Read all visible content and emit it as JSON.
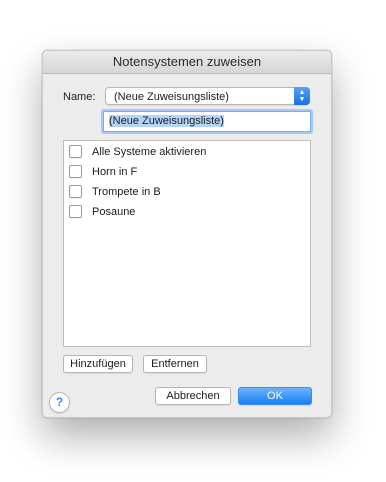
{
  "dialog": {
    "title": "Notensystemen zuweisen",
    "name_label": "Name:",
    "popup_value": "(Neue Zuweisungsliste)",
    "text_field_value": "(Neue Zuweisungsliste)",
    "list_items": [
      {
        "label": "Alle Systeme aktivieren",
        "checked": false
      },
      {
        "label": "Horn in F",
        "checked": false
      },
      {
        "label": "Trompete in B",
        "checked": false
      },
      {
        "label": "Posaune",
        "checked": false
      }
    ],
    "add_label": "Hinzufügen",
    "remove_label": "Entfernen",
    "cancel_label": "Abbrechen",
    "ok_label": "OK",
    "help_label": "?"
  },
  "colors": {
    "accent": "#1a7ef7",
    "dialog_bg": "#ececec"
  }
}
